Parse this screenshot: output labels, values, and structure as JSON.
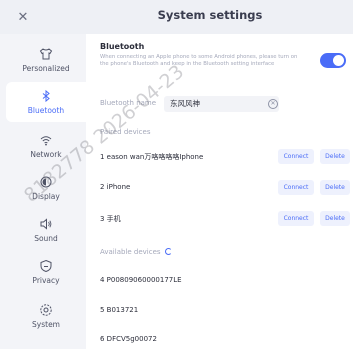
{
  "header": {
    "title": "System settings",
    "close_icon": "close-icon"
  },
  "sidebar": {
    "items": [
      {
        "label": "Personalized",
        "icon": "shirt-icon"
      },
      {
        "label": "Bluetooth",
        "icon": "bluetooth-icon",
        "active": true
      },
      {
        "label": "Network",
        "icon": "wifi-icon"
      },
      {
        "label": "Display",
        "icon": "display-icon"
      },
      {
        "label": "Sound",
        "icon": "speaker-icon"
      },
      {
        "label": "Privacy",
        "icon": "shield-icon"
      },
      {
        "label": "System",
        "icon": "gear-icon"
      }
    ]
  },
  "bluetooth": {
    "title": "Bluetooth",
    "description": "When connecting an Apple phone to some Android phones, please turn on the phone's Bluetooth and keep in the Bluetooth setting interface",
    "enabled": true,
    "name_label": "Bluetooth name",
    "name_value": "东风风神"
  },
  "paired": {
    "label": "Paired devices",
    "devices": [
      {
        "name": "1  eason wan万咯咯咯咯Iphone",
        "connect": "Connect",
        "delete": "Delete"
      },
      {
        "name": "2  iPhone",
        "connect": "Connect",
        "delete": "Delete"
      },
      {
        "name": "3  手机",
        "connect": "Connect",
        "delete": "Delete"
      }
    ]
  },
  "available": {
    "label": "Available devices",
    "devices": [
      {
        "name": "4  P00809060000177LE"
      },
      {
        "name": "5  B013721"
      },
      {
        "name": "6  DFCV5g00072"
      }
    ]
  },
  "watermark": "8182778 2026-04-23",
  "colors": {
    "accent": "#4a6cf7",
    "sidebar_bg": "#f3f4f8",
    "page_bg": "#ffffff"
  }
}
